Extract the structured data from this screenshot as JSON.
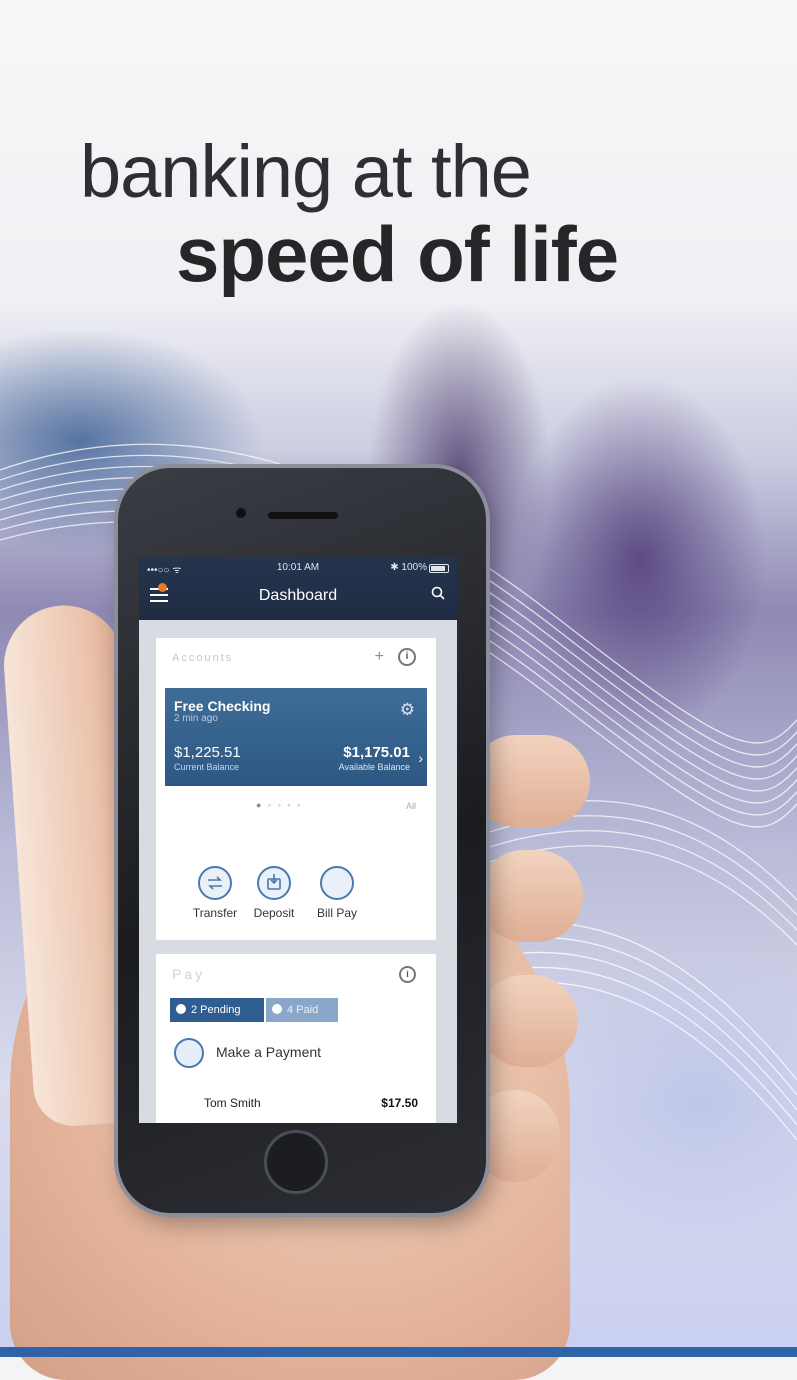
{
  "headline": {
    "line1": "banking at the",
    "line2": "speed of life"
  },
  "status_bar": {
    "signal": "•••○○ ᯤ",
    "time": "10:01 AM",
    "battery": "✱ 100%"
  },
  "nav": {
    "title": "Dashboard"
  },
  "accounts": {
    "faded_title": "Accounts",
    "account_name": "Free Checking",
    "updated": "2 min ago",
    "current_balance": "$1,225.51",
    "current_balance_label": "Current Balance",
    "available_balance": "$1,175.01",
    "available_balance_label": "Available Balance",
    "pager": "● ◦ ◦ ◦ ◦",
    "faded_right": "All"
  },
  "quick_actions": [
    {
      "label": "Transfer"
    },
    {
      "label": "Deposit"
    },
    {
      "label": "Bill Pay"
    }
  ],
  "payments": {
    "faded_title": "Pay",
    "tabs": {
      "pending": "2 Pending",
      "paid": "4 Paid",
      "third": ""
    },
    "make_payment": "Make a Payment",
    "payee": "Tom Smith",
    "amount": "$17.50"
  },
  "colors": {
    "appbar": "#25344d",
    "account_tile": "#2c5883",
    "accent": "#2f5d8f",
    "badge": "#e37c2d"
  },
  "icons": [
    "menu-icon",
    "search-icon",
    "plus-icon",
    "info-icon",
    "gear-icon",
    "chevron-right-icon",
    "transfer-icon",
    "deposit-icon",
    "bill-pay-icon",
    "payment-icon"
  ]
}
